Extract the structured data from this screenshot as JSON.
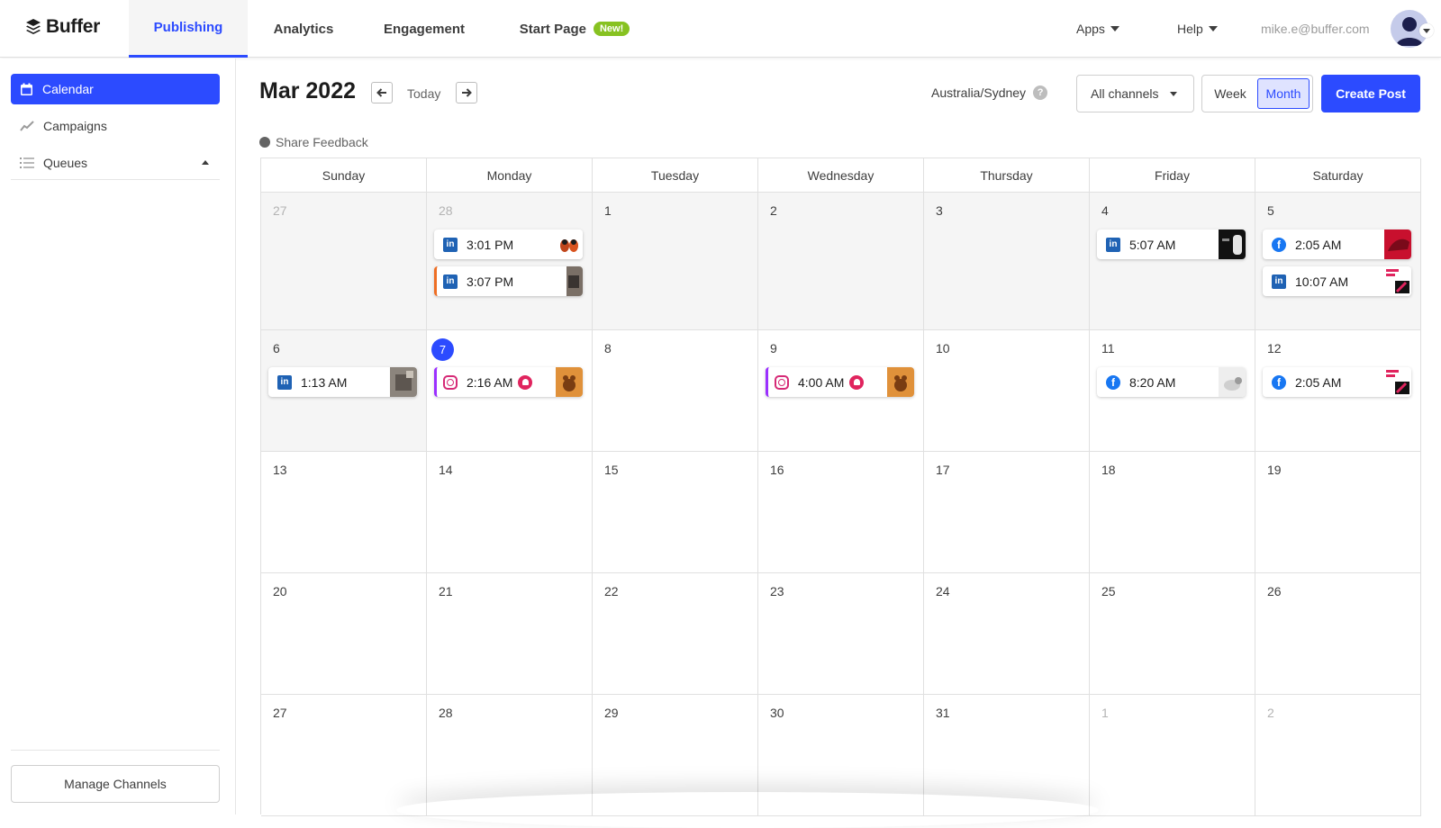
{
  "colors": {
    "accent": "#2c4bff",
    "new_badge": "#87c221",
    "linkedin": "#1f62b4",
    "facebook": "#1877f2",
    "instagram": "#d62976"
  },
  "header": {
    "logo": "Buffer",
    "tabs": [
      {
        "label": "Publishing",
        "active": true
      },
      {
        "label": "Analytics"
      },
      {
        "label": "Engagement"
      },
      {
        "label": "Start Page",
        "badge": "New!"
      }
    ],
    "apps_label": "Apps",
    "help_label": "Help",
    "user_email": "mike.e@buffer.com"
  },
  "sidebar": {
    "items": [
      {
        "label": "Calendar",
        "icon": "calendar-icon",
        "active": true
      },
      {
        "label": "Campaigns",
        "icon": "trend-icon"
      },
      {
        "label": "Queues",
        "icon": "list-icon"
      }
    ],
    "manage_channels": "Manage Channels"
  },
  "toolbar": {
    "month": "Mar 2022",
    "today": "Today",
    "timezone": "Australia/Sydney",
    "timezone_help": "?",
    "channels_select": "All channels",
    "view_week": "Week",
    "view_month": "Month",
    "create_post": "Create Post",
    "share_feedback": "Share Feedback"
  },
  "calendar": {
    "weekdays": [
      "Sunday",
      "Monday",
      "Tuesday",
      "Wednesday",
      "Thursday",
      "Friday",
      "Saturday"
    ],
    "weeks": [
      [
        "27",
        "28",
        "1",
        "2",
        "3",
        "4",
        "5"
      ],
      [
        "6",
        "7",
        "8",
        "9",
        "10",
        "11",
        "12"
      ],
      [
        "13",
        "14",
        "15",
        "16",
        "17",
        "18",
        "19"
      ],
      [
        "20",
        "21",
        "22",
        "23",
        "24",
        "25",
        "26"
      ],
      [
        "27",
        "28",
        "29",
        "30",
        "31",
        "1",
        "2"
      ]
    ],
    "posts": [
      {
        "week": 0,
        "day": 1,
        "slot": 0,
        "channel": "linkedin",
        "time": "3:01 PM",
        "thumb": "shoes"
      },
      {
        "week": 0,
        "day": 1,
        "slot": 1,
        "channel": "linkedin",
        "time": "3:07 PM",
        "accent": "orange",
        "thumb": "dark"
      },
      {
        "week": 0,
        "day": 5,
        "slot": 0,
        "channel": "linkedin",
        "time": "5:07 AM",
        "thumb": "black"
      },
      {
        "week": 0,
        "day": 6,
        "slot": 0,
        "channel": "facebook",
        "time": "2:05 AM",
        "thumb": "red"
      },
      {
        "week": 0,
        "day": 6,
        "slot": 1,
        "channel": "linkedin",
        "time": "10:07 AM",
        "thumb": "sale"
      },
      {
        "week": 1,
        "day": 0,
        "slot": 0,
        "channel": "linkedin",
        "time": "1:13 AM",
        "thumb": "gray"
      },
      {
        "week": 1,
        "day": 1,
        "slot": 0,
        "channel": "instagram",
        "time": "2:16 AM",
        "accent": "purple",
        "reminder": true,
        "thumb": "orange"
      },
      {
        "week": 1,
        "day": 3,
        "slot": 0,
        "channel": "instagram",
        "time": "4:00 AM",
        "accent": "purple",
        "reminder": true,
        "thumb": "orange"
      },
      {
        "week": 1,
        "day": 5,
        "slot": 0,
        "channel": "facebook",
        "time": "8:20 AM",
        "thumb": "light"
      },
      {
        "week": 1,
        "day": 6,
        "slot": 0,
        "channel": "facebook",
        "time": "2:05 AM",
        "thumb": "sale"
      }
    ]
  }
}
